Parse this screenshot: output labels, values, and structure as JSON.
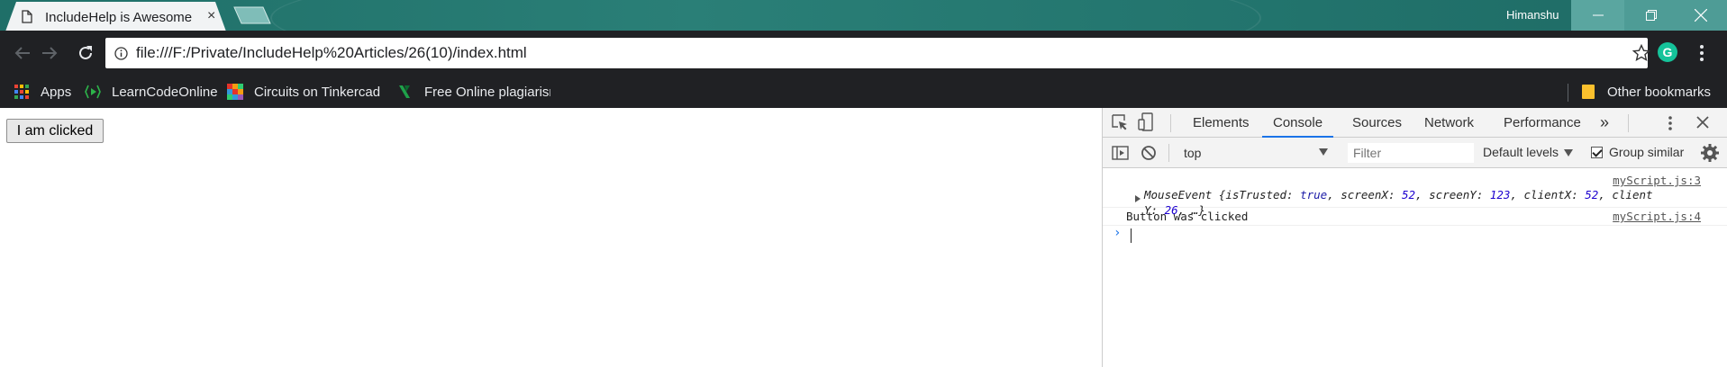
{
  "browser": {
    "tab_title": "IncludeHelp is Awesome",
    "tab_close": "×",
    "user_name": "Himanshu",
    "url": "file:///F:/Private/IncludeHelp%20Articles/26(10)/index.html",
    "extension_letter": "G"
  },
  "bookmarks": {
    "items": [
      {
        "label": "Apps",
        "icon": "apps-grid-icon"
      },
      {
        "label": "LearnCodeOnline",
        "icon": "learncodeonline-icon"
      },
      {
        "label": "Circuits on Tinkercad",
        "icon": "tinkercad-icon"
      },
      {
        "label": "Free Online plagiarism",
        "icon": "plagiarism-icon"
      }
    ],
    "other_label": "Other bookmarks"
  },
  "page": {
    "button_label": "I am clicked"
  },
  "devtools": {
    "tabs": [
      {
        "label": "Elements",
        "active": false
      },
      {
        "label": "Console",
        "active": true
      },
      {
        "label": "Sources",
        "active": false
      },
      {
        "label": "Network",
        "active": false
      },
      {
        "label": "Performance",
        "active": false
      }
    ],
    "more_tabs": "»",
    "context": "top",
    "filter_placeholder": "Filter",
    "levels_label": "Default levels",
    "group_similar_label": "Group similar",
    "group_similar_checked": true,
    "messages": [
      {
        "source": "myScript.js:3",
        "object_line1_prefix": "MouseEvent {",
        "fields_line1": [
          {
            "key": "isTrusted: ",
            "value": "true",
            "sep": ", "
          },
          {
            "key": "screenX: ",
            "value": "52",
            "sep": ", "
          },
          {
            "key": "screenY: ",
            "value": "123",
            "sep": ", "
          },
          {
            "key": "clientX: ",
            "value": "52",
            "sep": ", "
          },
          {
            "key": "client",
            "value": "",
            "sep": ""
          }
        ],
        "object_line2_key": "Y: ",
        "object_line2_value": "26",
        "object_line2_suffix": ", …}"
      },
      {
        "text": "Button was clicked",
        "source": "myScript.js:4"
      }
    ],
    "prompt_symbol": "›"
  },
  "colors": {
    "title_bar": "#23756e",
    "toolbar": "#202124",
    "accent": "#1a73e8"
  }
}
